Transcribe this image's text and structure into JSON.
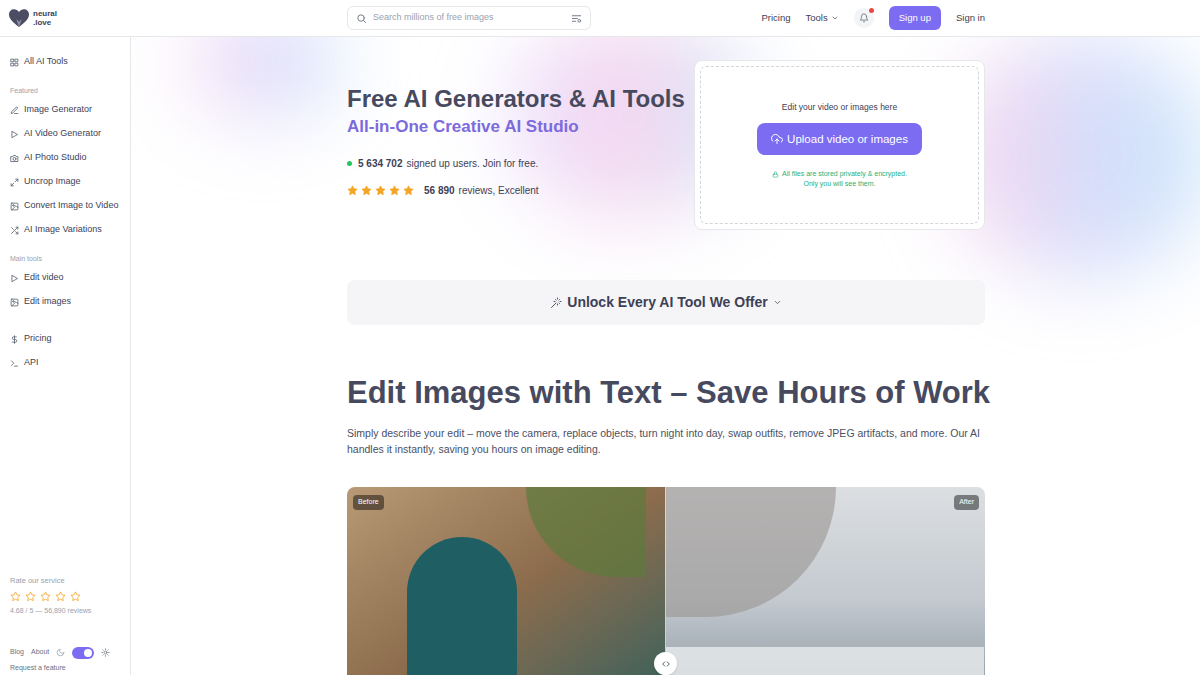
{
  "header": {
    "logo": {
      "line1": "neural",
      "line2": ".love"
    },
    "search": {
      "placeholder": "Search millions of free images"
    },
    "nav": [
      {
        "label": "Pricing",
        "dropdown": false
      },
      {
        "label": "Tools",
        "dropdown": true
      }
    ],
    "notifications": {
      "unread": true
    },
    "signup": "Sign up",
    "signin": "Sign in"
  },
  "sidebar": {
    "top": {
      "label": "All AI Tools"
    },
    "sections": [
      {
        "title": "Featured",
        "items": [
          {
            "label": "Image Generator"
          },
          {
            "label": "AI Video Generator"
          },
          {
            "label": "AI Photo Studio"
          },
          {
            "label": "Uncrop Image"
          },
          {
            "label": "Convert Image to Video"
          },
          {
            "label": "AI Image Variations"
          }
        ]
      },
      {
        "title": "Main tools",
        "items": [
          {
            "label": "Edit video"
          },
          {
            "label": "Edit images"
          }
        ]
      }
    ],
    "extra": [
      {
        "label": "Pricing"
      },
      {
        "label": "API"
      }
    ],
    "rating": {
      "title": "Rate our service",
      "stars": 0,
      "summary": "4.68 / 5 — 56,890 reviews"
    },
    "footer": {
      "links": [
        "Blog",
        "About"
      ],
      "theme_toggle": {
        "on": true
      },
      "request": "Request a feature"
    }
  },
  "hero": {
    "title": "Free AI Generators & AI Tools",
    "subtitle": "All-in-One Creative AI Studio",
    "users": {
      "count": "5 634 702",
      "text": "signed up users. Join for free."
    },
    "reviews": {
      "stars": 5,
      "count": "56 890",
      "text": "reviews, Excellent"
    }
  },
  "upload": {
    "prompt": "Edit your video or images here",
    "button": "Upload video or images",
    "note": [
      "All files are stored privately & encrypted.",
      "Only you will see them."
    ]
  },
  "unlock": {
    "label": "Unlock Every AI Tool We Offer"
  },
  "section": {
    "title": "Edit Images with Text – Save Hours of Work",
    "description": "Simply describe your edit – move the camera, replace objects, turn night into day, swap outfits, remove JPEG artifacts, and more. Our AI handles it instantly, saving you hours on image editing.",
    "comparison": {
      "before": "Before",
      "after": "After"
    }
  }
}
